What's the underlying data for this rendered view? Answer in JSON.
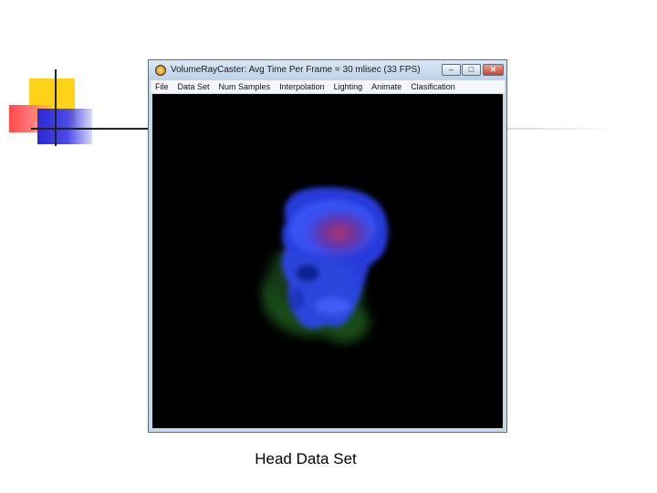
{
  "window": {
    "title": "VolumeRayCaster: Avg Time Per Frame = 30 mlisec (33 FPS)",
    "controls": {
      "minimize": "–",
      "maximize": "□",
      "close": "✕"
    }
  },
  "menu": {
    "items": [
      "File",
      "Data Set",
      "Num Samples",
      "Interpolation",
      "Lighting",
      "Animate",
      "Clasification"
    ]
  },
  "caption": "Head Data Set",
  "colors": {
    "render_background": "#000000",
    "volume_blue": "#2d46ff",
    "volume_green": "#2f8a2f",
    "volume_red": "#b8305a"
  },
  "icons": {
    "app": "app-icon",
    "logo": "slide-logo-decoration"
  }
}
